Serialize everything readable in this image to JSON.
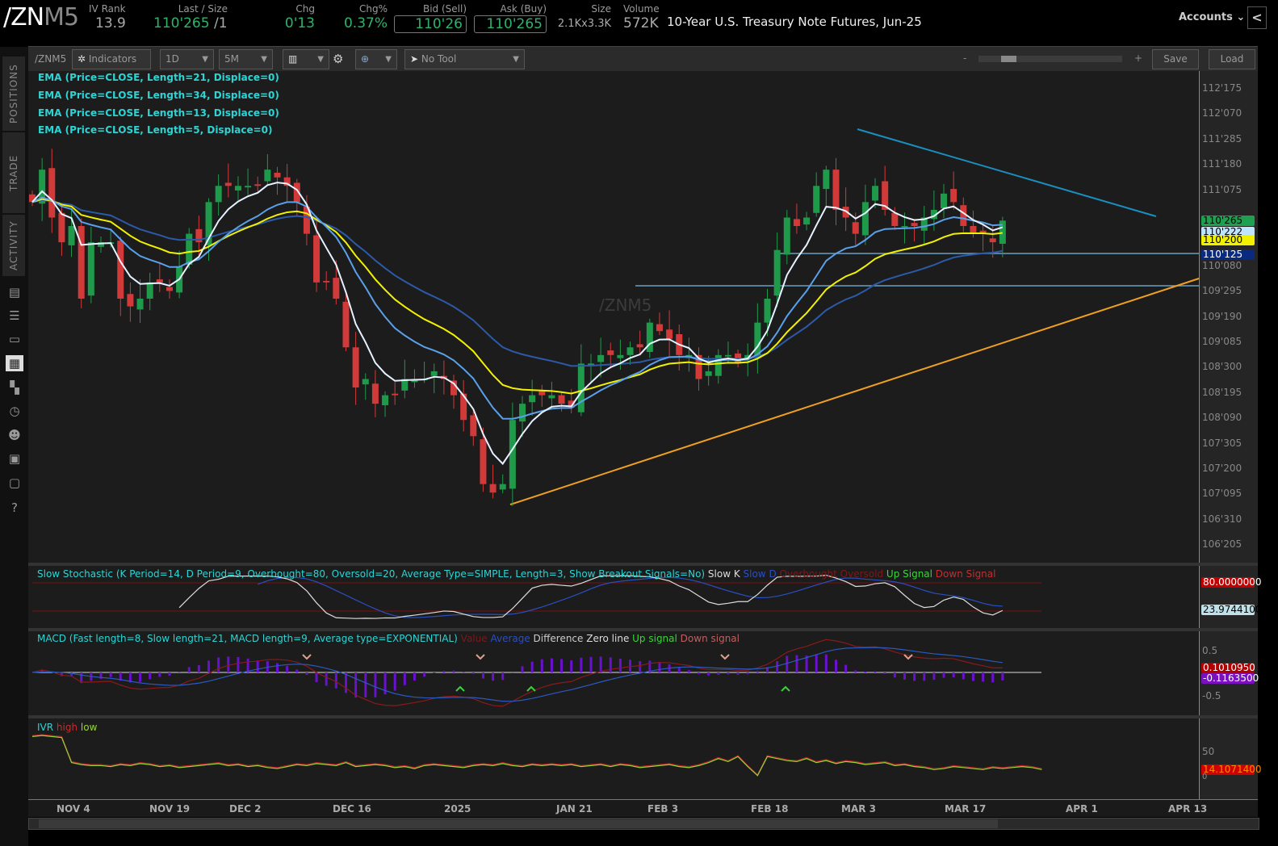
{
  "header": {
    "symbol_main": "/ZN",
    "symbol_month": "M5",
    "iv_rank": {
      "label": "IV Rank",
      "value": "13.9"
    },
    "last": {
      "label": "Last / Size",
      "value": "110'265",
      "size": "/1"
    },
    "chg": {
      "label": "Chg",
      "value": "0'13"
    },
    "chg_pct": {
      "label": "Chg%",
      "value": "0.37%"
    },
    "bid": {
      "label": "Bid (Sell)",
      "value": "110'26"
    },
    "ask": {
      "label": "Ask (Buy)",
      "value": "110'265"
    },
    "size": {
      "label": "Size",
      "value": "2.1Kx3.3K"
    },
    "volume": {
      "label": "Volume",
      "value": "572K"
    },
    "title": "10-Year U.S. Treasury Note Futures, Jun-25",
    "accounts": "Accounts",
    "collapse": "<"
  },
  "toolbar": {
    "symbol": "/ZNM5",
    "indicators": "Indicators",
    "aggregation": "1D",
    "timeframe": "5M",
    "tool": "No Tool",
    "zoom_minus": "-",
    "zoom_plus": "+",
    "save": "Save",
    "load": "Load"
  },
  "sidebar": {
    "tabs": [
      "POSITIONS",
      "TRADE",
      "ACTIVITY"
    ]
  },
  "main": {
    "watermark": "/ZNM5",
    "studies": [
      "EMA (Price=CLOSE, Length=21, Displace=0)",
      "EMA (Price=CLOSE, Length=34, Displace=0)",
      "EMA (Price=CLOSE, Length=13, Displace=0)",
      "EMA (Price=CLOSE, Length=5, Displace=0)"
    ],
    "price_ticks": [
      "112'175",
      "112'070",
      "111'285",
      "111'180",
      "111'075",
      "110'080",
      "109'295",
      "109'190",
      "109'085",
      "108'300",
      "108'195",
      "108'090",
      "107'305",
      "107'200",
      "107'095",
      "106'310",
      "106'205"
    ],
    "badges": [
      {
        "value": "110'265",
        "bg": "#1fa050",
        "fg": "#000"
      },
      {
        "value": "110'222",
        "bg": "#bfe4ff",
        "fg": "#000"
      },
      {
        "value": "110'200",
        "bg": "#f0f000",
        "fg": "#000"
      },
      {
        "value": "110'125",
        "bg": "#0a2a80",
        "fg": "#fff"
      }
    ],
    "colors": {
      "up": "#1f9a4a",
      "down": "#d23a3a",
      "ema5": "#e6f2ff",
      "ema13": "#5aa0ea",
      "ema21": "#f2f200",
      "ema34": "#2c5aa8",
      "trend_down": "#1a8fbf",
      "trend_up": "#f0a020",
      "support": "#6aa0c0"
    },
    "closes": [
      111.07,
      111.49,
      110.87,
      110.55,
      110.76,
      109.82,
      110.55,
      110.55,
      110.55,
      109.82,
      109.72,
      109.82,
      110.03,
      110.03,
      109.92,
      110.24,
      110.66,
      110.55,
      111.07,
      111.28,
      111.28,
      111.28,
      111.28,
      111.28,
      111.49,
      111.39,
      111.28,
      111.07,
      110.66,
      110.03,
      110.03,
      109.82,
      109.19,
      108.67,
      108.78,
      108.46,
      108.57,
      108.57,
      108.78,
      108.78,
      108.78,
      108.88,
      108.78,
      108.57,
      108.25,
      108.04,
      107.42,
      107.31,
      107.42,
      108.25,
      108.46,
      108.57,
      108.57,
      108.57,
      108.46,
      108.41,
      108.98,
      108.98,
      109.09,
      109.09,
      109.09,
      109.19,
      109.19,
      109.51,
      109.4,
      109.3,
      109.09,
      109.09,
      108.78,
      108.88,
      109.09,
      109.09,
      108.98,
      109.09,
      109.51,
      109.82,
      110.45,
      110.87,
      110.76,
      110.87,
      111.28,
      111.49,
      110.97,
      110.87,
      110.66,
      111.07,
      111.28,
      110.97,
      110.76,
      110.76,
      110.76,
      110.87,
      110.97,
      111.18,
      111.07,
      110.76,
      110.66,
      110.66,
      110.55,
      110.83
    ]
  },
  "stochastic": {
    "title": "Slow Stochastic (K Period=14, D Period=9, Overbought=80, Oversold=20, Average Type=SIMPLE, Length=3, Show Breakout Signals=No)",
    "legend": [
      {
        "t": "Slow K",
        "c": "#ddd"
      },
      {
        "t": "Slow D",
        "c": "#2a4fc0"
      },
      {
        "t": "Overbought",
        "c": "#7a1a1a"
      },
      {
        "t": "Oversold",
        "c": "#7a1a1a"
      },
      {
        "t": "Up Signal",
        "c": "#3ad43a"
      },
      {
        "t": "Down Signal",
        "c": "#c03030"
      }
    ],
    "ticks": [
      "80.0000000",
      "23.9744100"
    ],
    "k_period": 14,
    "d_period": 9,
    "overbought": 80,
    "oversold": 20,
    "smooth": 3
  },
  "macd": {
    "title": "MACD (Fast length=8, Slow length=21, MACD length=9, Average type=EXPONENTIAL)",
    "legend": [
      {
        "t": "Value",
        "c": "#7a1a1a"
      },
      {
        "t": "Average",
        "c": "#2a4fc0"
      },
      {
        "t": "Difference",
        "c": "#ccc"
      },
      {
        "t": "Zero line",
        "c": "#ddd"
      },
      {
        "t": "Up signal",
        "c": "#3ad43a"
      },
      {
        "t": "Down signal",
        "c": "#c06060"
      }
    ],
    "ticks": [
      "0.5",
      "-0.5"
    ],
    "badges": [
      "0.1010950",
      "-0.1163500"
    ],
    "fast": 8,
    "slow": 21,
    "signal": 9
  },
  "ivr": {
    "legend": [
      {
        "t": "IVR",
        "c": "#2ed4d4"
      },
      {
        "t": "high",
        "c": "#c03030"
      },
      {
        "t": "low",
        "c": "#9ad43a"
      }
    ],
    "tick": "50",
    "zero": "0",
    "badge": "14.1071400",
    "values": [
      80,
      82,
      80,
      78,
      28,
      24,
      22,
      22,
      20,
      24,
      22,
      26,
      24,
      20,
      22,
      18,
      20,
      22,
      24,
      26,
      22,
      24,
      20,
      22,
      18,
      16,
      20,
      24,
      22,
      26,
      24,
      22,
      28,
      20,
      22,
      24,
      22,
      18,
      20,
      16,
      22,
      24,
      22,
      20,
      18,
      22,
      24,
      22,
      26,
      22,
      20,
      24,
      22,
      24,
      22,
      24,
      20,
      22,
      24,
      20,
      24,
      22,
      18,
      20,
      22,
      24,
      20,
      18,
      22,
      28,
      36,
      30,
      40,
      20,
      2,
      40,
      36,
      32,
      30,
      36,
      28,
      32,
      26,
      30,
      28,
      24,
      26,
      28,
      22,
      24,
      20,
      18,
      14,
      16,
      20,
      18,
      16,
      14,
      18,
      16,
      18,
      20,
      18,
      14
    ]
  },
  "dates": [
    "NOV 4",
    "NOV 19",
    "DEC 2",
    "DEC 16",
    "2025",
    "JAN 21",
    "FEB 3",
    "FEB 18",
    "MAR 3",
    "MAR 17",
    "APR 1",
    "APR 13"
  ]
}
